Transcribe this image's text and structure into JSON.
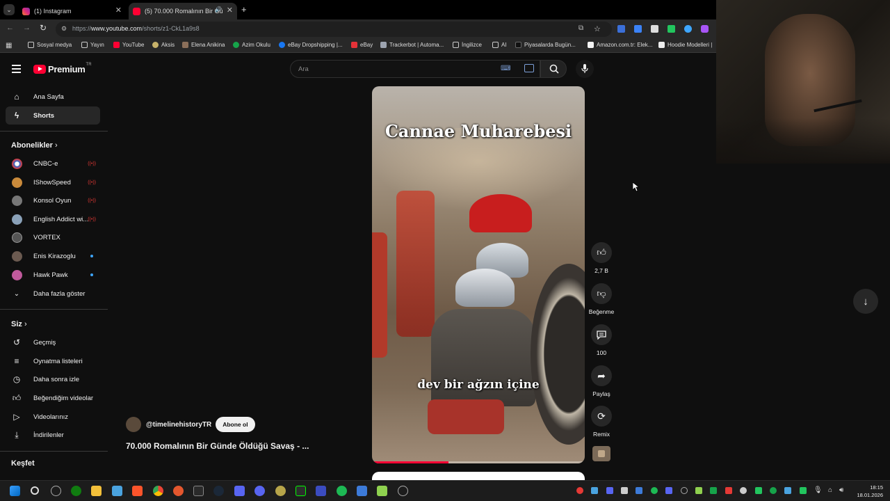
{
  "browser": {
    "tabs": [
      {
        "title": "(1) Instagram",
        "close": "✕"
      },
      {
        "title": "(5) 70.000 Romalının Bir Gü",
        "close": "✕"
      }
    ],
    "new_tab": "+",
    "url_prefix": "https://",
    "url_host": "www.youtube.com",
    "url_path": "/shorts/z1-CkL1a9s8",
    "bookmarks": [
      "Sosyal medya",
      "Yayın",
      "YouTube",
      "Aksis",
      "Elena Anikina",
      "Azim Okulu",
      "eBay Dropshipping |...",
      "eBay",
      "Trackerbot | Automa...",
      "İngilizce",
      "AI",
      "Piyasalarda Bugün...",
      "Amazon.com.tr: Elek...",
      "Hoodie Modelleri |"
    ]
  },
  "masthead": {
    "logo": "Premium",
    "region": "TR",
    "search_placeholder": "Ara"
  },
  "sidebar": {
    "main": [
      {
        "label": "Ana Sayfa",
        "icon": "home-icon"
      },
      {
        "label": "Shorts",
        "icon": "shorts-icon"
      }
    ],
    "subs_header": "Abonelikler",
    "subscriptions": [
      {
        "label": "CNBC-e",
        "status": "live"
      },
      {
        "label": "IShowSpeed",
        "status": "live"
      },
      {
        "label": "Konsol Oyun",
        "status": "live"
      },
      {
        "label": "English Addict wi...",
        "status": "live"
      },
      {
        "label": "VORTEX",
        "status": ""
      },
      {
        "label": "Enis Kirazoglu",
        "status": "new"
      },
      {
        "label": "Hawk Pawk",
        "status": "new"
      }
    ],
    "show_more": "Daha fazla göster",
    "you_header": "Siz",
    "you": [
      {
        "label": "Geçmiş",
        "icon": "history-icon"
      },
      {
        "label": "Oynatma listeleri",
        "icon": "playlist-icon"
      },
      {
        "label": "Daha sonra izle",
        "icon": "watch-later-icon"
      },
      {
        "label": "Beğendiğim videolar",
        "icon": "liked-icon"
      },
      {
        "label": "Videolarınız",
        "icon": "your-videos-icon"
      },
      {
        "label": "İndirilenler",
        "icon": "downloads-icon"
      }
    ],
    "explore_header": "Keşfet"
  },
  "short": {
    "title_overlay": "Cannae Muharebesi",
    "subtitle_overlay": "dev bir ağzın içine",
    "channel": "@timelinehistoryTR",
    "subscribe": "Abone ol",
    "video_title": "70.000 Romalının Bir Günde Öldüğü Savaş - ...",
    "progress": 0.36,
    "actions": {
      "like_count": "2,7 B",
      "dislike_label": "Beğenme",
      "comment_count": "100",
      "share_label": "Paylaş",
      "remix_label": "Remix"
    }
  },
  "taskbar": {
    "time": "18:15",
    "date": "18.01.2026"
  },
  "colors": {
    "background": "#0f0f0f",
    "youtube_red": "#ff0033",
    "live_red": "#e53935",
    "new_dot": "#3ea6ff"
  }
}
